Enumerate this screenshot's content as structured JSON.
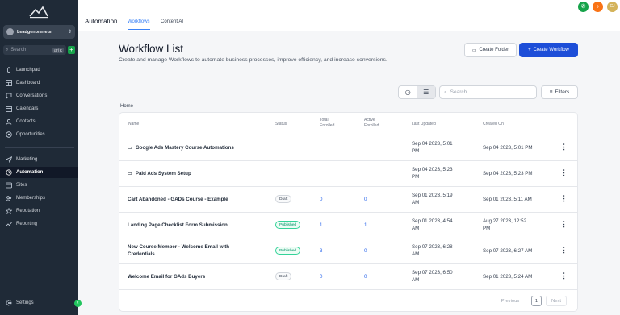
{
  "sidebar": {
    "account_name": "Leadgenpreneur",
    "search_placeholder": "Search",
    "search_shortcut": "ctrl K",
    "nav_top": [
      {
        "label": "Launchpad",
        "icon": "rocket-icon"
      },
      {
        "label": "Dashboard",
        "icon": "dashboard-icon"
      },
      {
        "label": "Conversations",
        "icon": "chat-icon"
      },
      {
        "label": "Calendars",
        "icon": "calendar-icon"
      },
      {
        "label": "Contacts",
        "icon": "contacts-icon"
      },
      {
        "label": "Opportunities",
        "icon": "opportunities-icon"
      }
    ],
    "nav_bottom": [
      {
        "label": "Marketing",
        "icon": "send-icon"
      },
      {
        "label": "Automation",
        "icon": "automation-icon",
        "active": true
      },
      {
        "label": "Sites",
        "icon": "sites-icon"
      },
      {
        "label": "Memberships",
        "icon": "memberships-icon"
      },
      {
        "label": "Reputation",
        "icon": "star-icon"
      },
      {
        "label": "Reporting",
        "icon": "reporting-icon"
      }
    ],
    "settings_label": "Settings"
  },
  "topbar": {
    "title": "Automation",
    "tabs": [
      "Workflows",
      "Content AI"
    ],
    "active_tab": "Workflows",
    "icons": [
      {
        "name": "phone-icon",
        "color": "#16a34a"
      },
      {
        "name": "bell-icon",
        "color": "#f97316"
      },
      {
        "name": "user-avatar-icon",
        "color": "#d4b35a",
        "text": "CJ"
      }
    ]
  },
  "main": {
    "title": "Workflow List",
    "description": "Create and manage Workflows to automate business processes, improve efficiency, and increase conversions.",
    "create_folder_label": "Create Folder",
    "create_workflow_label": "Create Workflow",
    "search_placeholder": "Search",
    "filters_label": "Filters",
    "breadcrumb": "Home",
    "columns": {
      "name": "Name",
      "status": "Status",
      "total_enrolled": [
        "Total",
        "Enrolled"
      ],
      "active_enrolled": [
        "Active",
        "Enrolled"
      ],
      "last_updated": "Last Updated",
      "created_on": "Created On"
    },
    "rows": [
      {
        "name": "Google Ads Mastery Course Automations",
        "is_folder": true,
        "status": "",
        "total": "",
        "active": "",
        "updated": [
          "Sep 04 2023, 5:01",
          "PM"
        ],
        "created": [
          "Sep 04 2023, 5:01 PM"
        ]
      },
      {
        "name": "Paid Ads System Setup",
        "is_folder": true,
        "status": "",
        "total": "",
        "active": "",
        "updated": [
          "Sep 04 2023, 5:23",
          "PM"
        ],
        "created": [
          "Sep 04 2023, 5:23 PM"
        ]
      },
      {
        "name": "Cart Abandoned - GADs Course - Example",
        "is_folder": false,
        "status": "Draft",
        "total": "0",
        "active": "0",
        "updated": [
          "Sep 01 2023, 5:19",
          "AM"
        ],
        "created": [
          "Sep 01 2023, 5:11 AM"
        ]
      },
      {
        "name": "Landing Page Checklist Form Submission",
        "is_folder": false,
        "status": "Published",
        "total": "1",
        "active": "1",
        "updated": [
          "Sep 01 2023, 4:54",
          "AM"
        ],
        "created": [
          "Aug 27 2023, 12:52",
          "PM"
        ]
      },
      {
        "name": "New Course Member - Welcome Email with Credentials",
        "is_folder": false,
        "status": "Published",
        "total": "3",
        "active": "0",
        "updated": [
          "Sep 07 2023, 6:28",
          "AM"
        ],
        "created": [
          "Sep 07 2023, 6:27 AM"
        ]
      },
      {
        "name": "Welcome Email for GAds Buyers",
        "is_folder": false,
        "status": "Draft",
        "total": "0",
        "active": "0",
        "updated": [
          "Sep 07 2023, 6:50",
          "AM"
        ],
        "created": [
          "Sep 01 2023, 5:24 AM"
        ]
      }
    ],
    "pagination": {
      "previous": "Previous",
      "current": "1",
      "next": "Next"
    }
  }
}
